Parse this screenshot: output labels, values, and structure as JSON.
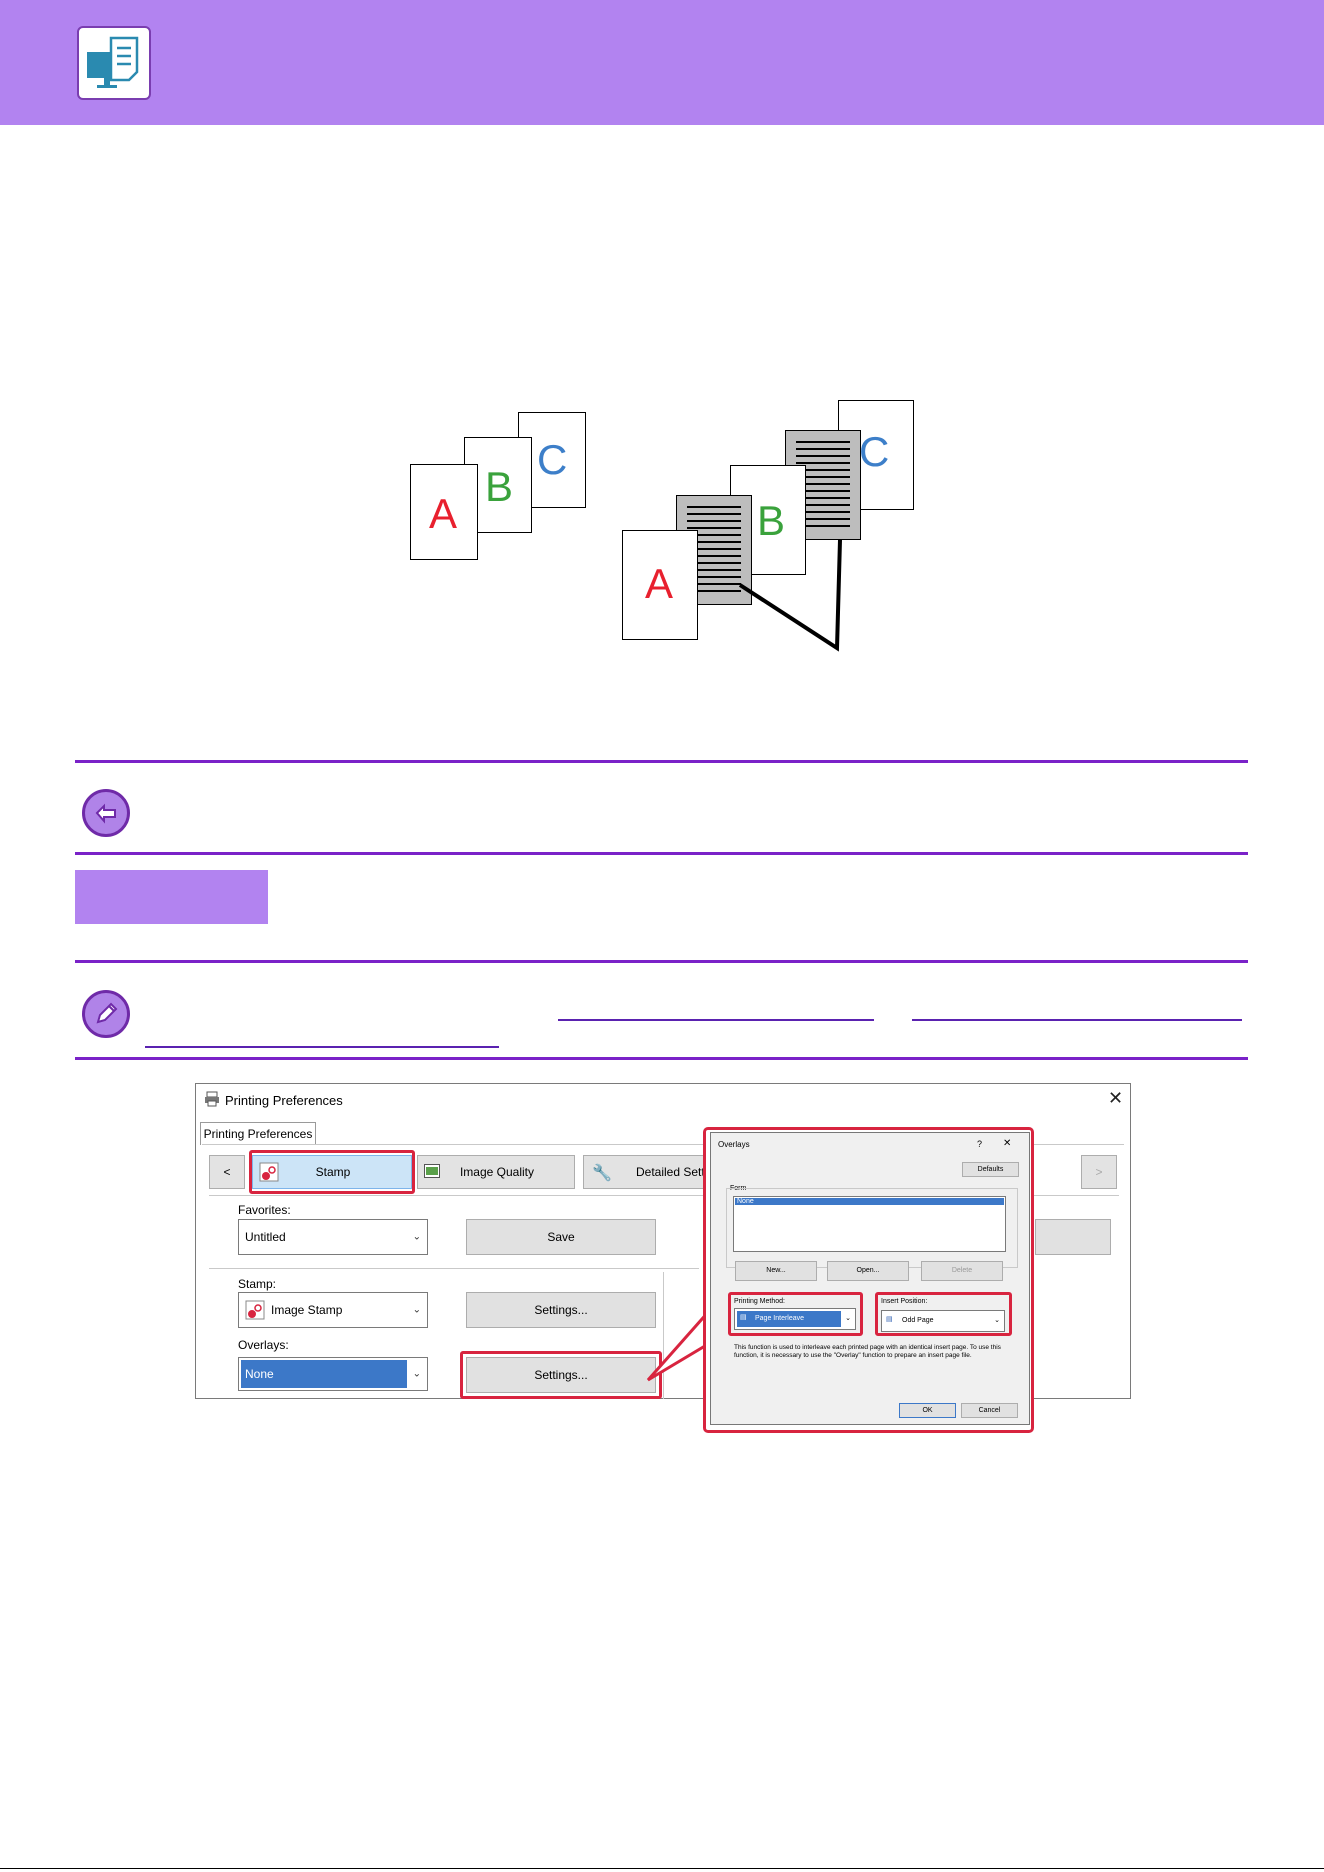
{
  "diagram": {
    "letters": [
      "A",
      "B",
      "C"
    ],
    "colors": {
      "a": "#e8202e",
      "b": "#3aa23c",
      "c": "#3d7fc9"
    }
  },
  "printing_preferences": {
    "window_title": "Printing Preferences",
    "tab": "Printing Preferences",
    "toolbar": {
      "prev": "<",
      "next": ">",
      "stamp": "Stamp",
      "image_quality": "Image Quality",
      "detailed_settings": "Detailed Sett"
    },
    "favorites": {
      "label": "Favorites:",
      "value": "Untitled",
      "save": "Save"
    },
    "stamp": {
      "label": "Stamp:",
      "value": "Image Stamp",
      "settings": "Settings..."
    },
    "overlays": {
      "label": "Overlays:",
      "value": "None",
      "settings": "Settings..."
    }
  },
  "overlays_dialog": {
    "title": "Overlays",
    "help": "?",
    "close": "✕",
    "defaults": "Defaults",
    "form_label": "Form",
    "form_list": [
      "None"
    ],
    "new": "New...",
    "open": "Open...",
    "delete": "Delete",
    "printing_method_label": "Printing Method:",
    "printing_method_value": "Page Interleave",
    "insert_position_label": "Insert Position:",
    "insert_position_value": "Odd Page",
    "description": "This function is used to interleave each printed page with an identical insert page. To use this function, it is necessary to use the \"Overlay\" function to prepare an insert page file.",
    "ok": "OK",
    "cancel": "Cancel"
  },
  "accent": "#b283f0",
  "highlight": "#d8243f",
  "selection": "#3c78c8"
}
